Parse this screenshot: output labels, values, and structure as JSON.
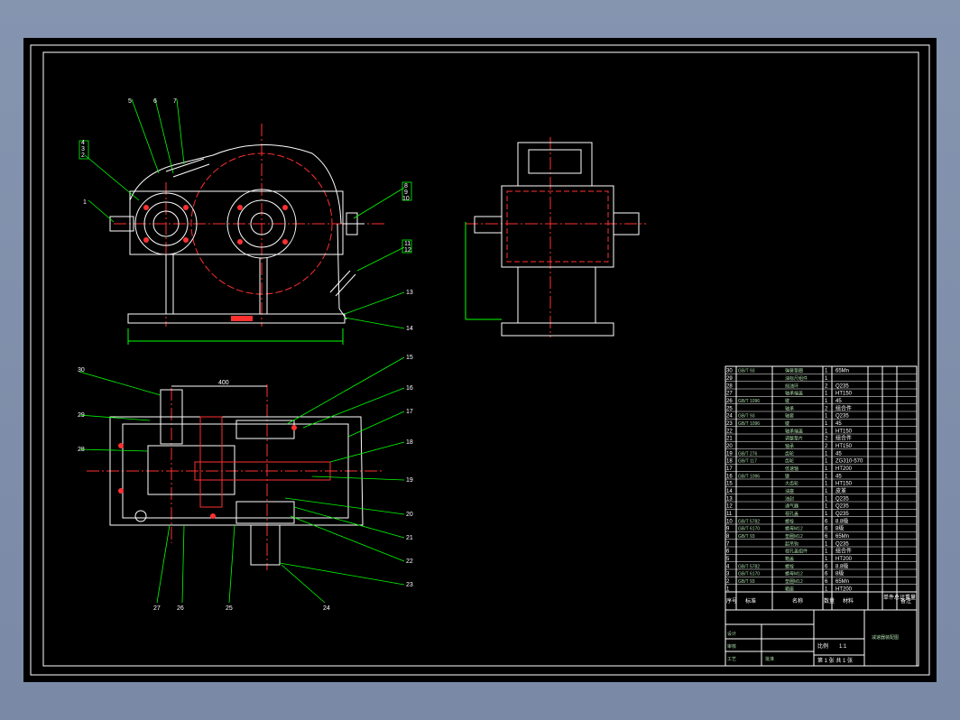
{
  "drawing": {
    "front_view_labels": [
      "5",
      "6",
      "7",
      "4",
      "3",
      "2",
      "1",
      "8",
      "9",
      "10",
      "11",
      "12",
      "13",
      "14"
    ],
    "plan_view_labels": [
      "30",
      "29",
      "28",
      "15",
      "16",
      "17",
      "18",
      "19",
      "20",
      "21",
      "22",
      "23",
      "27",
      "26",
      "25",
      "24"
    ],
    "dim_text": "400"
  },
  "parts_list": {
    "rows": [
      {
        "no": "30",
        "std": "GB/T 93",
        "name": "弹簧垫圈",
        "qty": "1",
        "mat": "65Mn"
      },
      {
        "no": "29",
        "std": "",
        "name": "油标尺组件",
        "qty": "1",
        "mat": ""
      },
      {
        "no": "28",
        "std": "",
        "name": "挡油环",
        "qty": "2",
        "mat": "Q235"
      },
      {
        "no": "27",
        "std": "",
        "name": "轴承端盖",
        "qty": "1",
        "mat": "HT150"
      },
      {
        "no": "26",
        "std": "GB/T 1096",
        "name": "键",
        "qty": "1",
        "mat": "45"
      },
      {
        "no": "25",
        "std": "",
        "name": "轴承",
        "qty": "2",
        "mat": "组合件"
      },
      {
        "no": "24",
        "std": "GB/T 93",
        "name": "轴套",
        "qty": "1",
        "mat": "Q235"
      },
      {
        "no": "23",
        "std": "GB/T 1096",
        "name": "键",
        "qty": "1",
        "mat": "45"
      },
      {
        "no": "22",
        "std": "",
        "name": "轴承端盖",
        "qty": "1",
        "mat": "HT150"
      },
      {
        "no": "21",
        "std": "",
        "name": "调整垫片",
        "qty": "2",
        "mat": "组合件"
      },
      {
        "no": "20",
        "std": "",
        "name": "轴承",
        "qty": "2",
        "mat": "HT150"
      },
      {
        "no": "19",
        "std": "GB/T 276",
        "name": "齿轮",
        "qty": "1",
        "mat": "45"
      },
      {
        "no": "18",
        "std": "GB/T 117",
        "name": "齿轮",
        "qty": "1",
        "mat": "ZG310-570"
      },
      {
        "no": "17",
        "std": "",
        "name": "低速轴",
        "qty": "1",
        "mat": "HT200"
      },
      {
        "no": "16",
        "std": "GB/T 1096",
        "name": "键",
        "qty": "1",
        "mat": "45"
      },
      {
        "no": "15",
        "std": "",
        "name": "大齿轮",
        "qty": "1",
        "mat": "HT150"
      },
      {
        "no": "14",
        "std": "",
        "name": "油塞",
        "qty": "1",
        "mat": "皮革"
      },
      {
        "no": "13",
        "std": "",
        "name": "油封",
        "qty": "1",
        "mat": "Q235"
      },
      {
        "no": "12",
        "std": "",
        "name": "通气器",
        "qty": "1",
        "mat": "Q235"
      },
      {
        "no": "11",
        "std": "",
        "name": "视孔盖",
        "qty": "1",
        "mat": "Q235"
      },
      {
        "no": "10",
        "std": "GB/T 5782",
        "name": "螺栓",
        "qty": "6",
        "mat": "8.8级"
      },
      {
        "no": "9",
        "std": "GB/T 6170",
        "name": "螺母M12",
        "qty": "6",
        "mat": "8级"
      },
      {
        "no": "8",
        "std": "GB/T 93",
        "name": "垫圈M12",
        "qty": "6",
        "mat": "65Mn"
      },
      {
        "no": "7",
        "std": "",
        "name": "起吊钩",
        "qty": "1",
        "mat": "Q235"
      },
      {
        "no": "6",
        "std": "",
        "name": "视孔盖组件",
        "qty": "1",
        "mat": "组合件"
      },
      {
        "no": "5",
        "std": "",
        "name": "箱盖",
        "qty": "1",
        "mat": "HT200"
      },
      {
        "no": "4",
        "std": "GB/T 5782",
        "name": "螺栓",
        "qty": "6",
        "mat": "8.8级"
      },
      {
        "no": "3",
        "std": "GB/T 6170",
        "name": "螺母M12",
        "qty": "6",
        "mat": "8级"
      },
      {
        "no": "2",
        "std": "GB/T 93",
        "name": "垫圈M12",
        "qty": "6",
        "mat": "65Mn"
      },
      {
        "no": "1",
        "std": "",
        "name": "箱座",
        "qty": "1",
        "mat": "HT200"
      }
    ],
    "header": {
      "no": "序号",
      "std": "标准",
      "name": "名称",
      "qty": "数量",
      "mat": "材料",
      "weight": "单件总计重量",
      "remark": "备注"
    }
  },
  "title_block": {
    "design": "设计",
    "check": "审核",
    "process": "工艺",
    "approve": "批准",
    "scale_label": "比例",
    "scale": "1:1",
    "sheet": "第 1 张 共 1 张",
    "title": "减速器装配图"
  }
}
